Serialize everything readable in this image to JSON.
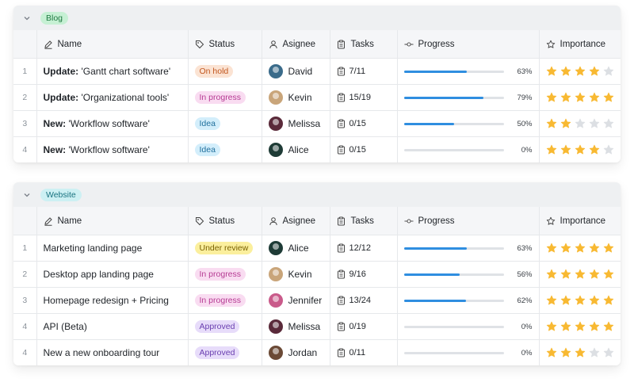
{
  "columns": {
    "name": "Name",
    "status": "Status",
    "assignee": "Asignee",
    "tasks": "Tasks",
    "progress": "Progress",
    "importance": "Importance"
  },
  "colors": {
    "progress_fill": "#2f8ee0",
    "star_on": "#f8b932",
    "star_off": "#dcdfe3"
  },
  "status_styles": {
    "On hold": {
      "bg": "#fbe3d3",
      "fg": "#c2571f"
    },
    "In progress": {
      "bg": "#f9dcf1",
      "fg": "#b63a93"
    },
    "Idea": {
      "bg": "#d3eefb",
      "fg": "#1f6f9c"
    },
    "Under review": {
      "bg": "#fbef9d",
      "fg": "#7a6100"
    },
    "Approved": {
      "bg": "#e7dcfa",
      "fg": "#6a3fb0"
    }
  },
  "avatar_colors": {
    "David": "#3a6b8a",
    "Kevin": "#c9a57a",
    "Melissa": "#5a2a3a",
    "Alice": "#1e3b36",
    "Jennifer": "#c95a8a",
    "Jordan": "#6b4a36"
  },
  "groups": [
    {
      "label": "Blog",
      "tag_bg": "#c6f0d4",
      "tag_fg": "#1f7a42",
      "rows": [
        {
          "idx": "1",
          "bold": "Update:",
          "name": " 'Gantt chart software'",
          "status": "On hold",
          "assignee": "David",
          "tasks": "7/11",
          "progress": 63,
          "progress_label": "63%",
          "importance": 4
        },
        {
          "idx": "2",
          "bold": "Update:",
          "name": " 'Organizational tools'",
          "status": "In progress",
          "assignee": "Kevin",
          "tasks": "15/19",
          "progress": 79,
          "progress_label": "79%",
          "importance": 5
        },
        {
          "idx": "3",
          "bold": "New:",
          "name": " 'Workflow software'",
          "status": "Idea",
          "assignee": "Melissa",
          "tasks": "0/15",
          "progress": 50,
          "progress_label": "50%",
          "importance": 2
        },
        {
          "idx": "4",
          "bold": "New:",
          "name": " 'Workflow software'",
          "status": "Idea",
          "assignee": "Alice",
          "tasks": "0/15",
          "progress": 0,
          "progress_label": "0%",
          "importance": 4
        }
      ]
    },
    {
      "label": "Website",
      "tag_bg": "#cdf0f3",
      "tag_fg": "#1a7380",
      "rows": [
        {
          "idx": "1",
          "bold": "",
          "name": "Marketing landing page",
          "status": "Under review",
          "assignee": "Alice",
          "tasks": "12/12",
          "progress": 63,
          "progress_label": "63%",
          "importance": 5
        },
        {
          "idx": "2",
          "bold": "",
          "name": "Desktop app landing page",
          "status": "In progress",
          "assignee": "Kevin",
          "tasks": "9/16",
          "progress": 56,
          "progress_label": "56%",
          "importance": 5
        },
        {
          "idx": "3",
          "bold": "",
          "name": "Homepage redesign + Pricing",
          "status": "In progress",
          "assignee": "Jennifer",
          "tasks": "13/24",
          "progress": 62,
          "progress_label": "62%",
          "importance": 5
        },
        {
          "idx": "4",
          "bold": "",
          "name": "API (Beta)",
          "status": "Approved",
          "assignee": "Melissa",
          "tasks": "0/19",
          "progress": 0,
          "progress_label": "0%",
          "importance": 5
        },
        {
          "idx": "4",
          "bold": "",
          "name": "New a new onboarding tour",
          "status": "Approved",
          "assignee": "Jordan",
          "tasks": "0/11",
          "progress": 0,
          "progress_label": "0%",
          "importance": 3
        }
      ]
    }
  ]
}
